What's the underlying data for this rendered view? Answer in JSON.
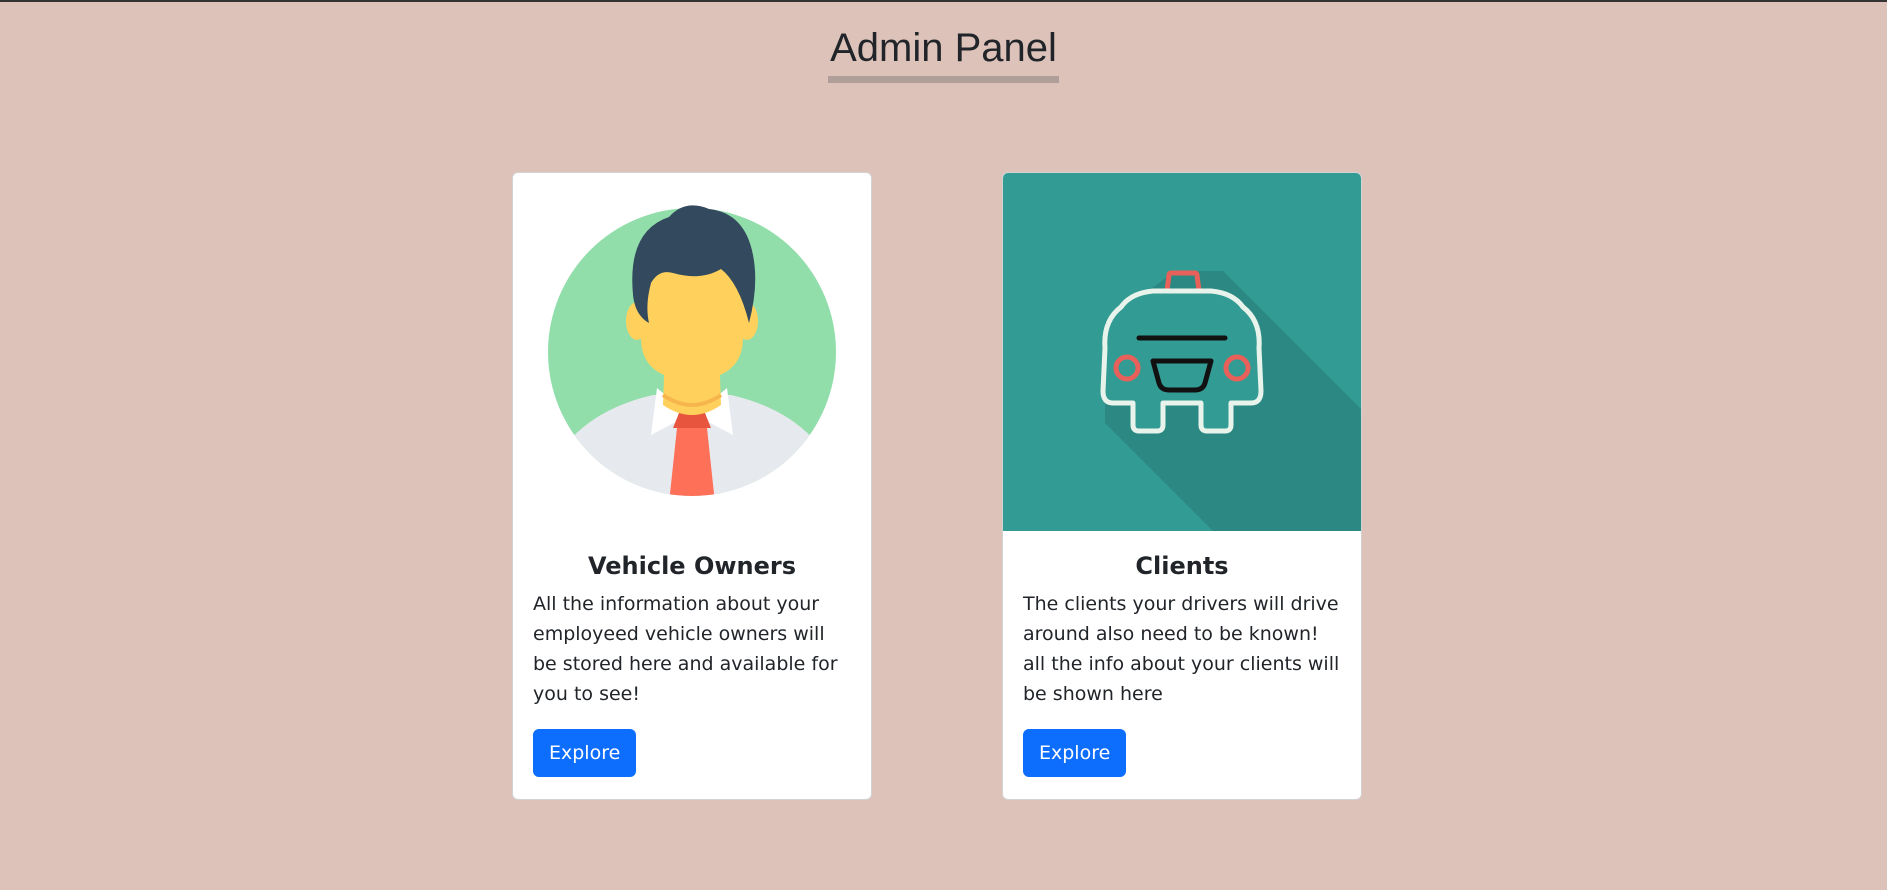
{
  "header": {
    "title": "Admin Panel"
  },
  "cards": [
    {
      "title": "Vehicle Owners",
      "text": "All the information about your employeed vehicle owners will be stored here and available for you to see!",
      "button_label": "Explore",
      "image_icon": "person-avatar-icon"
    },
    {
      "title": "Clients",
      "text": "The clients your drivers will drive around also need to be known! all the info about your clients will be shown here",
      "button_label": "Explore",
      "image_icon": "taxi-car-icon"
    }
  ],
  "colors": {
    "background": "#dcc2b9",
    "title_underline": "#b09f99",
    "button": "#0d6efd",
    "avatar_circle": "#92deab",
    "taxi_background": "#329b93"
  }
}
